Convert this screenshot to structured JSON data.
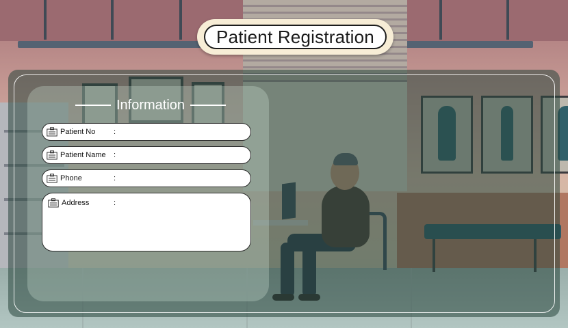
{
  "header": {
    "title": "Patient Registration"
  },
  "info_section": {
    "title": "Information"
  },
  "fields": [
    {
      "label": "Patient No",
      "value": ""
    },
    {
      "label": "Patient Name",
      "value": ""
    },
    {
      "label": "Phone",
      "value": ""
    },
    {
      "label": "Address",
      "value": ""
    }
  ],
  "separator": ":",
  "colors": {
    "header_bg": "#f7edd6",
    "panel_overlay": "#284638",
    "field_bg": "#ffffff",
    "field_border": "#2a2a2a"
  },
  "icons": {
    "field_icon": "id-card-icon"
  }
}
